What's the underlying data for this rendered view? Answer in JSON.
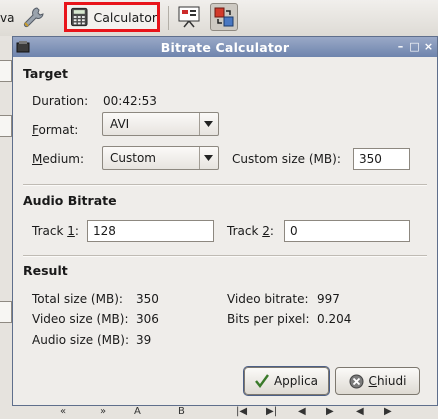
{
  "toolbar": {
    "partial_text": "va",
    "calculator_label": "Calculator"
  },
  "dialog": {
    "title": "Bitrate Calculator",
    "target": {
      "heading": "Target",
      "duration_label": "Duration:",
      "duration_value": "00:42:53",
      "format_label_prefix": "",
      "format_label_mnemonic": "F",
      "format_label_rest": "ormat:",
      "format_value": "AVI",
      "medium_label_mnemonic": "M",
      "medium_label_rest": "edium:",
      "medium_value": "Custom",
      "custom_size_label": "Custom size (MB):",
      "custom_size_value": "350"
    },
    "audio": {
      "heading": "Audio Bitrate",
      "track1_label_prefix": "Track ",
      "track1_label_mnemonic": "1",
      "track1_label_suffix": ":",
      "track1_value": "128",
      "track2_label_prefix": "Track ",
      "track2_label_mnemonic": "2",
      "track2_label_suffix": ":",
      "track2_value": "0"
    },
    "result": {
      "heading": "Result",
      "total_size_label": "Total size (MB):",
      "total_size_value": "350",
      "video_size_label": "Video size (MB):",
      "video_size_value": "306",
      "audio_size_label": "Audio size (MB):",
      "audio_size_value": "39",
      "video_bitrate_label": "Video bitrate:",
      "video_bitrate_value": "997",
      "bpp_label": "Bits per pixel:",
      "bpp_value": "0.204"
    },
    "buttons": {
      "apply_label": "Applica",
      "close_label_mnemonic": "C",
      "close_label_rest": "hiudi"
    }
  },
  "icons": {
    "wrench": "wrench-icon",
    "calculator": "calculator-icon",
    "preview": "preview-icon",
    "swap": "swap-icon",
    "apply": "checkmark-icon",
    "close": "close-circle-icon"
  },
  "colors": {
    "highlight_border": "#e8141a",
    "titlebar": "#7b90b6",
    "dialog_bg": "#efedea"
  }
}
